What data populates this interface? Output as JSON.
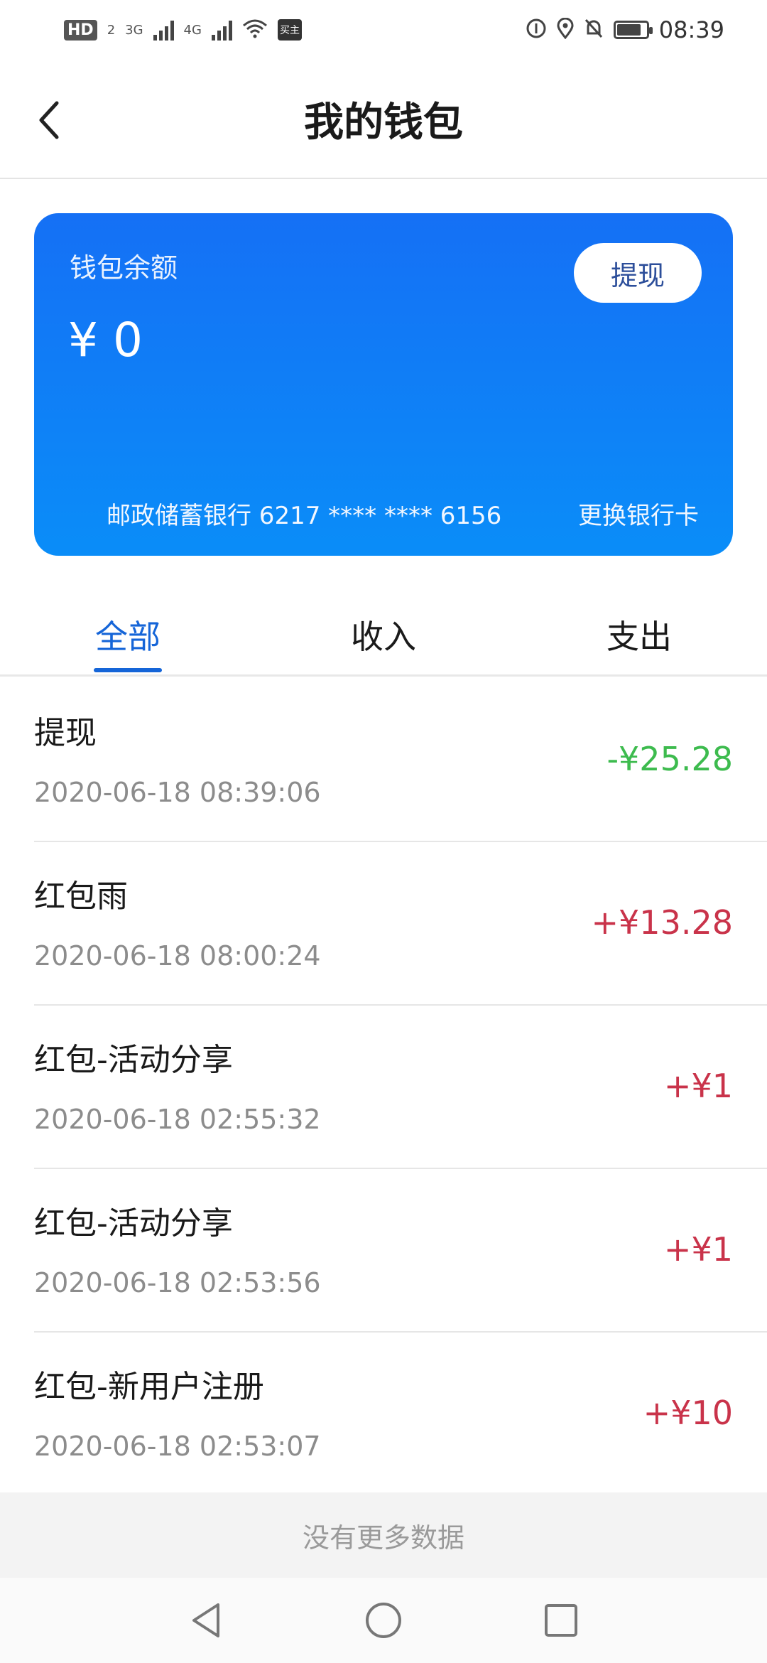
{
  "status_bar": {
    "hd": "HD",
    "hd_sub": "2",
    "sig1": "3G",
    "sig2": "4G",
    "app_badge": "买主",
    "time": "08:39"
  },
  "header": {
    "title": "我的钱包"
  },
  "wallet": {
    "balance_label": "钱包余额",
    "balance_amount": "¥ 0",
    "withdraw_label": "提现",
    "bank_info": "邮政储蓄银行  6217 **** **** 6156",
    "change_card_label": "更换银行卡"
  },
  "tabs": [
    {
      "label": "全部",
      "active": true
    },
    {
      "label": "收入",
      "active": false
    },
    {
      "label": "支出",
      "active": false
    }
  ],
  "transactions": [
    {
      "title": "提现",
      "time": "2020-06-18 08:39:06",
      "amount": "-¥25.28",
      "color": "#3dbb4e"
    },
    {
      "title": "红包雨",
      "time": "2020-06-18 08:00:24",
      "amount": "+¥13.28",
      "color": "#c9334a"
    },
    {
      "title": "红包-活动分享",
      "time": "2020-06-18 02:55:32",
      "amount": "+¥1",
      "color": "#c9334a"
    },
    {
      "title": "红包-活动分享",
      "time": "2020-06-18 02:53:56",
      "amount": "+¥1",
      "color": "#c9334a"
    },
    {
      "title": "红包-新用户注册",
      "time": "2020-06-18 02:53:07",
      "amount": "+¥10",
      "color": "#c9334a"
    }
  ],
  "footer": {
    "no_more": "没有更多数据"
  },
  "icons": {
    "back": "chevron-left-icon",
    "nav_back": "triangle-back-icon",
    "nav_home": "circle-home-icon",
    "nav_recent": "square-recent-icon"
  },
  "colors": {
    "accent": "#1565d8",
    "card_top": "#1570f5",
    "card_bottom": "#0a8df8",
    "income": "#c9334a",
    "expense": "#3dbb4e"
  }
}
